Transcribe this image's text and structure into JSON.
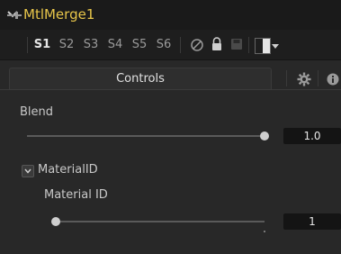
{
  "node": {
    "title": "MtlMerge1"
  },
  "toolbar": {
    "slots": [
      "S1",
      "S2",
      "S3",
      "S4",
      "S5",
      "S6"
    ],
    "active_slot": "S1"
  },
  "tabs": {
    "controls_label": "Controls"
  },
  "blend": {
    "label": "Blend",
    "value": "1.0",
    "level": 1.0
  },
  "material_id": {
    "checkbox_label": "MaterialID",
    "label": "Material ID",
    "value": "1"
  },
  "colors": {
    "title": "#e8c64a",
    "background": "#282828"
  }
}
